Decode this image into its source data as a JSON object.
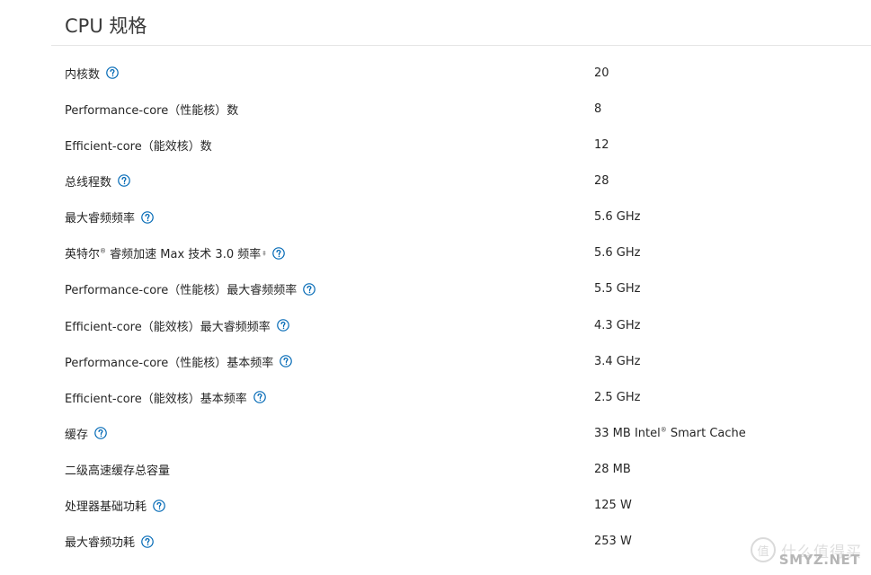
{
  "section": {
    "title": "CPU 规格"
  },
  "specs": [
    {
      "label": "内核数",
      "value": "20",
      "help": true
    },
    {
      "label": "Performance-core（性能核）数",
      "value": "8",
      "help": false
    },
    {
      "label": "Efficient-core（能效核）数",
      "value": "12",
      "help": false
    },
    {
      "label": "总线程数",
      "value": "28",
      "help": true
    },
    {
      "label": "最大睿频频率",
      "value": "5.6 GHz",
      "help": true
    },
    {
      "label_prefix": "英特尔",
      "tm": "®",
      "label_suffix": " 睿频加速 Max 技术 3.0 频率",
      "footnote": "‡",
      "value": "5.6 GHz",
      "help": true
    },
    {
      "label": "Performance-core（性能核）最大睿频频率",
      "value": "5.5 GHz",
      "help": true
    },
    {
      "label": "Efficient-core（能效核）最大睿频频率",
      "value": "4.3 GHz",
      "help": true
    },
    {
      "label": "Performance-core（性能核）基本频率",
      "value": "3.4 GHz",
      "help": true
    },
    {
      "label": "Efficient-core（能效核）基本频率",
      "value": "2.5 GHz",
      "help": true
    },
    {
      "label": "缓存",
      "value_prefix": "33 MB Intel",
      "value_tm": "®",
      "value_suffix": " Smart Cache",
      "help": true
    },
    {
      "label": "二级高速缓存总容量",
      "value": "28 MB",
      "help": false
    },
    {
      "label": "处理器基础功耗",
      "value": "125 W",
      "help": true
    },
    {
      "label": "最大睿频功耗",
      "value": "253 W",
      "help": true
    }
  ],
  "icons": {
    "help": "question-circle-icon",
    "help_color": "#0068b5"
  },
  "watermark": {
    "logo": "值",
    "text": "什么值得买",
    "sub": "SMYZ.NET"
  }
}
